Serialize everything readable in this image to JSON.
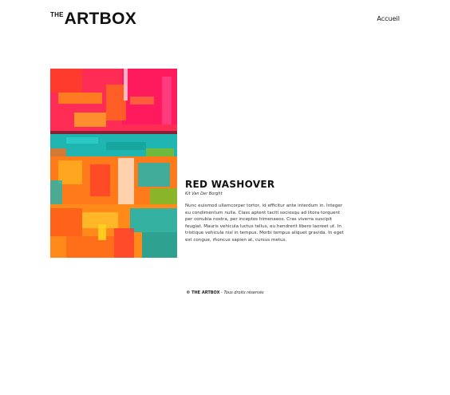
{
  "header": {
    "logo_the": "THE",
    "logo_main": "ARTBOX",
    "nav_home": "Accueil"
  },
  "artwork": {
    "title": "RED WASHOVER",
    "artist": "Kit Van Der Borght",
    "description": "Nunc euismod ullamcorper tortor, id efficitur ante interdum in. Integer eu condimentum nulla. Class aptent taciti sociosqu ad litora torquent per conubia nostra, per inceptos himenaeos. Cras viverra suscipit feugiat. Mauris vehicula luctus tellus, eu hendrerit libero laoreet ut. In tristique vehicula nisl in tempus. Morbi tempus aliquet gravida. In eget est congue, rhoncus sapien at, cursus metus.",
    "colors": [
      "#ff1a3d",
      "#ff6a1a",
      "#1fb5b0",
      "#7dbb2a",
      "#ffd21f"
    ]
  },
  "footer": {
    "brand": "© THE ARTBOX",
    "separator": " - ",
    "rights": "Tous droits réservés"
  }
}
